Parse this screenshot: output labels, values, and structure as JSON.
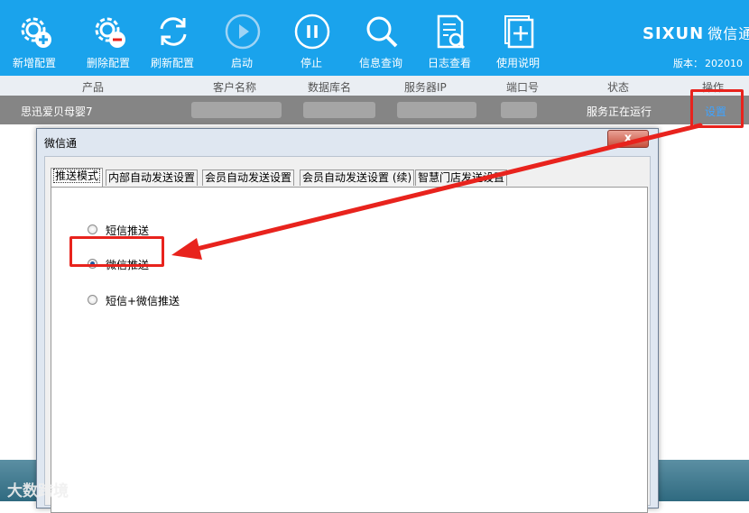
{
  "toolbar": {
    "buttons": [
      {
        "label": "新增配置",
        "icon": "gear-plus-icon"
      },
      {
        "label": "删除配置",
        "icon": "gear-minus-icon"
      },
      {
        "label": "刷新配置",
        "icon": "refresh-icon"
      },
      {
        "label": "启动",
        "icon": "play-icon"
      },
      {
        "label": "停止",
        "icon": "pause-icon"
      },
      {
        "label": "信息查询",
        "icon": "search-icon"
      },
      {
        "label": "日志查看",
        "icon": "log-search-icon"
      },
      {
        "label": "使用说明",
        "icon": "manual-icon"
      }
    ],
    "brand": "SIXUN",
    "brand_sub": "微信通",
    "version_label": "版本：",
    "version_value": "202010"
  },
  "table": {
    "columns": [
      "产品",
      "客户名称",
      "数据库名",
      "服务器IP",
      "端口号",
      "状态",
      "操作"
    ],
    "row": {
      "product": "思迅爱贝母婴7",
      "status": "服务正在运行",
      "action": "设置"
    }
  },
  "dialog": {
    "title": "微信通",
    "close_label": "x",
    "tabs": [
      "推送模式",
      "内部自动发送设置",
      "会员自动发送设置",
      "会员自动发送设置 (续)",
      "智慧门店发送设置"
    ],
    "active_tab": 0,
    "options": [
      {
        "label": "短信推送",
        "checked": false
      },
      {
        "label": "微信推送",
        "checked": true
      },
      {
        "label": "短信+微信推送",
        "checked": false
      }
    ]
  },
  "watermark": "大数跨境",
  "colors": {
    "toolbar": "#1aa3ec",
    "annotation": "#e8231d",
    "row_bg": "#858585"
  }
}
